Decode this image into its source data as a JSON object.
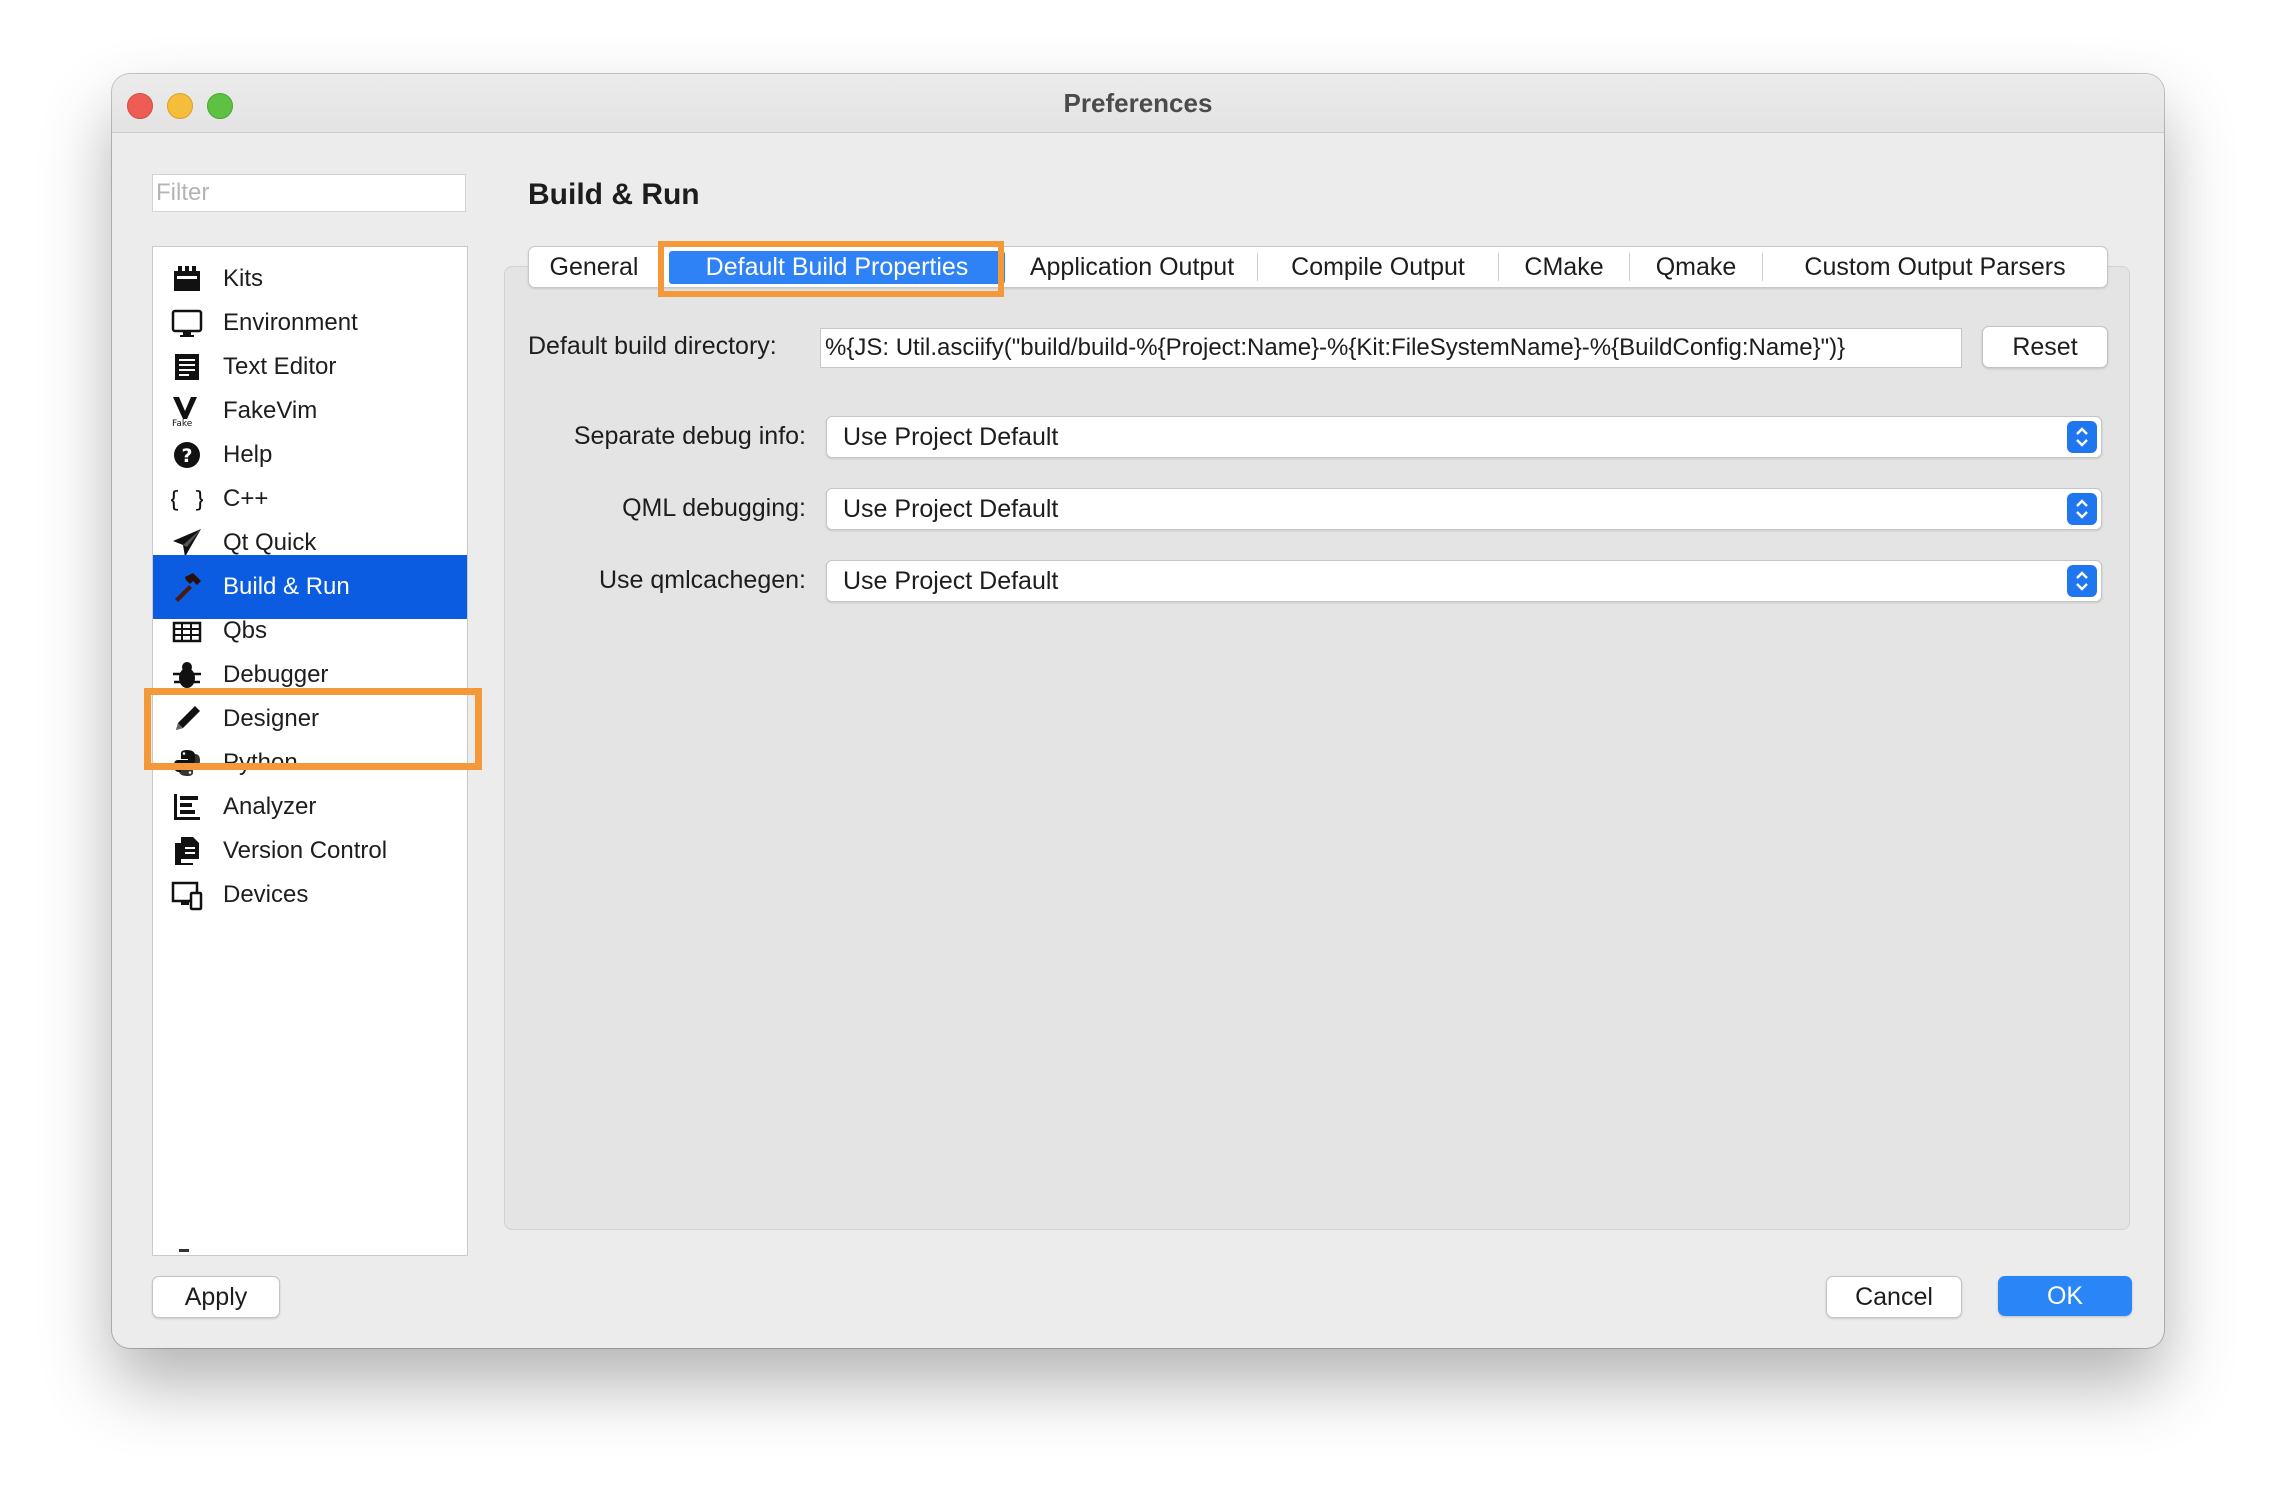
{
  "window": {
    "title": "Preferences"
  },
  "filter": {
    "placeholder": "Filter"
  },
  "sidebar": {
    "items": [
      {
        "label": "Kits",
        "icon": "kits-icon"
      },
      {
        "label": "Environment",
        "icon": "monitor-icon"
      },
      {
        "label": "Text Editor",
        "icon": "text-editor-icon"
      },
      {
        "label": "FakeVim",
        "icon": "fakevim-icon"
      },
      {
        "label": "Help",
        "icon": "help-icon"
      },
      {
        "label": "C++",
        "icon": "braces-icon"
      },
      {
        "label": "Qt Quick",
        "icon": "paper-plane-icon"
      },
      {
        "label": "Build & Run",
        "icon": "hammer-icon",
        "selected": true
      },
      {
        "label": "Qbs",
        "icon": "qbs-icon"
      },
      {
        "label": "Debugger",
        "icon": "bug-icon"
      },
      {
        "label": "Designer",
        "icon": "pencil-icon"
      },
      {
        "label": "Python",
        "icon": "python-icon"
      },
      {
        "label": "Analyzer",
        "icon": "analyzer-icon"
      },
      {
        "label": "Version Control",
        "icon": "version-control-icon"
      },
      {
        "label": "Devices",
        "icon": "devices-icon"
      }
    ]
  },
  "main": {
    "title": "Build & Run",
    "tabs": [
      {
        "label": "General"
      },
      {
        "label": "Default Build Properties",
        "active": true
      },
      {
        "label": "Application Output"
      },
      {
        "label": "Compile Output"
      },
      {
        "label": "CMake"
      },
      {
        "label": "Qmake"
      },
      {
        "label": "Custom Output Parsers"
      }
    ],
    "build_dir": {
      "label": "Default build directory:",
      "value": "%{JS: Util.asciify(\"build/build-%{Project:Name}-%{Kit:FileSystemName}-%{BuildConfig:Name}\")}",
      "reset_label": "Reset"
    },
    "options": [
      {
        "label": "Separate debug info:",
        "value": "Use Project Default"
      },
      {
        "label": "QML debugging:",
        "value": "Use Project Default"
      },
      {
        "label": "Use qmlcachegen:",
        "value": "Use Project Default"
      }
    ]
  },
  "footer": {
    "apply_label": "Apply",
    "cancel_label": "Cancel",
    "ok_label": "OK"
  },
  "colors": {
    "accent": "#2f82f5",
    "selection": "#0b5ce0",
    "highlight_box": "#f3993a"
  }
}
